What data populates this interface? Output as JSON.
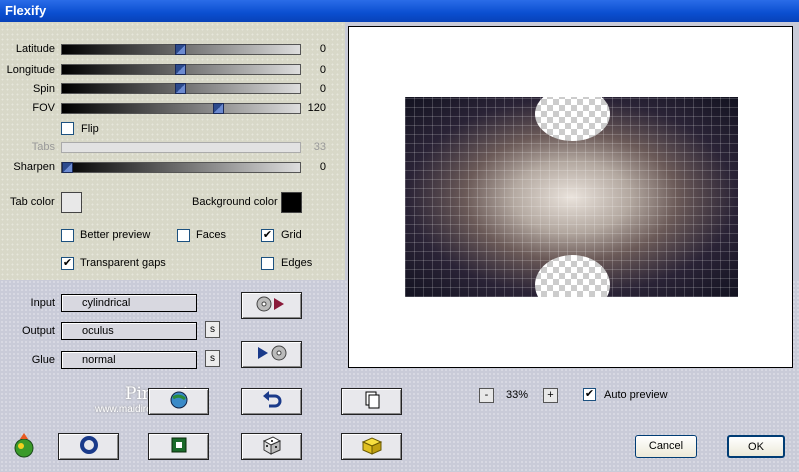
{
  "window": {
    "title": "Flexify"
  },
  "sliders": [
    {
      "label": "Latitude",
      "value": "0",
      "level": 0.5
    },
    {
      "label": "Longitude",
      "value": "0",
      "level": 0.5
    },
    {
      "label": "Spin",
      "value": "0",
      "level": 0.5
    },
    {
      "label": "FOV",
      "value": "120",
      "level": 0.67
    }
  ],
  "flip": {
    "label": "Flip",
    "checked": false
  },
  "tabs": {
    "label": "Tabs",
    "value": "33"
  },
  "sharpen": {
    "label": "Sharpen",
    "value": "0",
    "level": 0.0
  },
  "colors": {
    "tab_color_label": "Tab color",
    "tab_color": "#e8e8e8",
    "background_color_label": "Background color",
    "background_color": "#000000"
  },
  "options": {
    "better_preview": {
      "label": "Better preview",
      "checked": false
    },
    "faces": {
      "label": "Faces",
      "checked": false
    },
    "grid": {
      "label": "Grid",
      "checked": true
    },
    "transparent_gaps": {
      "label": "Transparent gaps",
      "checked": true
    },
    "edges": {
      "label": "Edges",
      "checked": false
    }
  },
  "fields": {
    "input_label": "Input",
    "input_value": "cylindrical",
    "output_label": "Output",
    "output_value": "oculus",
    "glue_label": "Glue",
    "glue_value": "normal",
    "s_label": "s"
  },
  "zoom": {
    "minus": "-",
    "value": "33%",
    "plus": "+"
  },
  "auto_preview": {
    "label": "Auto preview",
    "checked": true
  },
  "watermark": {
    "line1": "Pinuccia",
    "line2": "www.maidireGrafica.eu"
  },
  "buttons": {
    "cancel": "Cancel",
    "ok": "OK"
  }
}
